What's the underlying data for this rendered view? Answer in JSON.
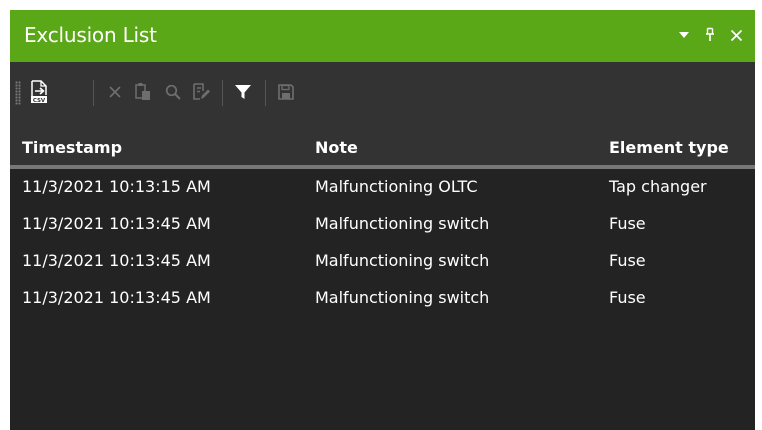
{
  "window": {
    "title": "Exclusion List",
    "accent": "#5aa717"
  },
  "toolbar": {
    "buttons": [
      {
        "icon": "export-csv-icon",
        "enabled": true
      },
      {
        "icon": "delete-icon",
        "enabled": false
      },
      {
        "icon": "paste-icon",
        "enabled": false
      },
      {
        "icon": "search-icon",
        "enabled": false
      },
      {
        "icon": "edit-icon",
        "enabled": false
      },
      {
        "icon": "filter-icon",
        "enabled": true
      },
      {
        "icon": "save-icon",
        "enabled": false
      }
    ]
  },
  "table": {
    "columns": [
      "Timestamp",
      "Note",
      "Element type"
    ],
    "rows": [
      [
        "11/3/2021 10:13:15 AM",
        "Malfunctioning OLTC",
        "Tap changer"
      ],
      [
        "11/3/2021 10:13:45 AM",
        "Malfunctioning switch",
        "Fuse"
      ],
      [
        "11/3/2021 10:13:45 AM",
        "Malfunctioning switch",
        "Fuse"
      ],
      [
        "11/3/2021 10:13:45 AM",
        "Malfunctioning switch",
        "Fuse"
      ]
    ]
  }
}
